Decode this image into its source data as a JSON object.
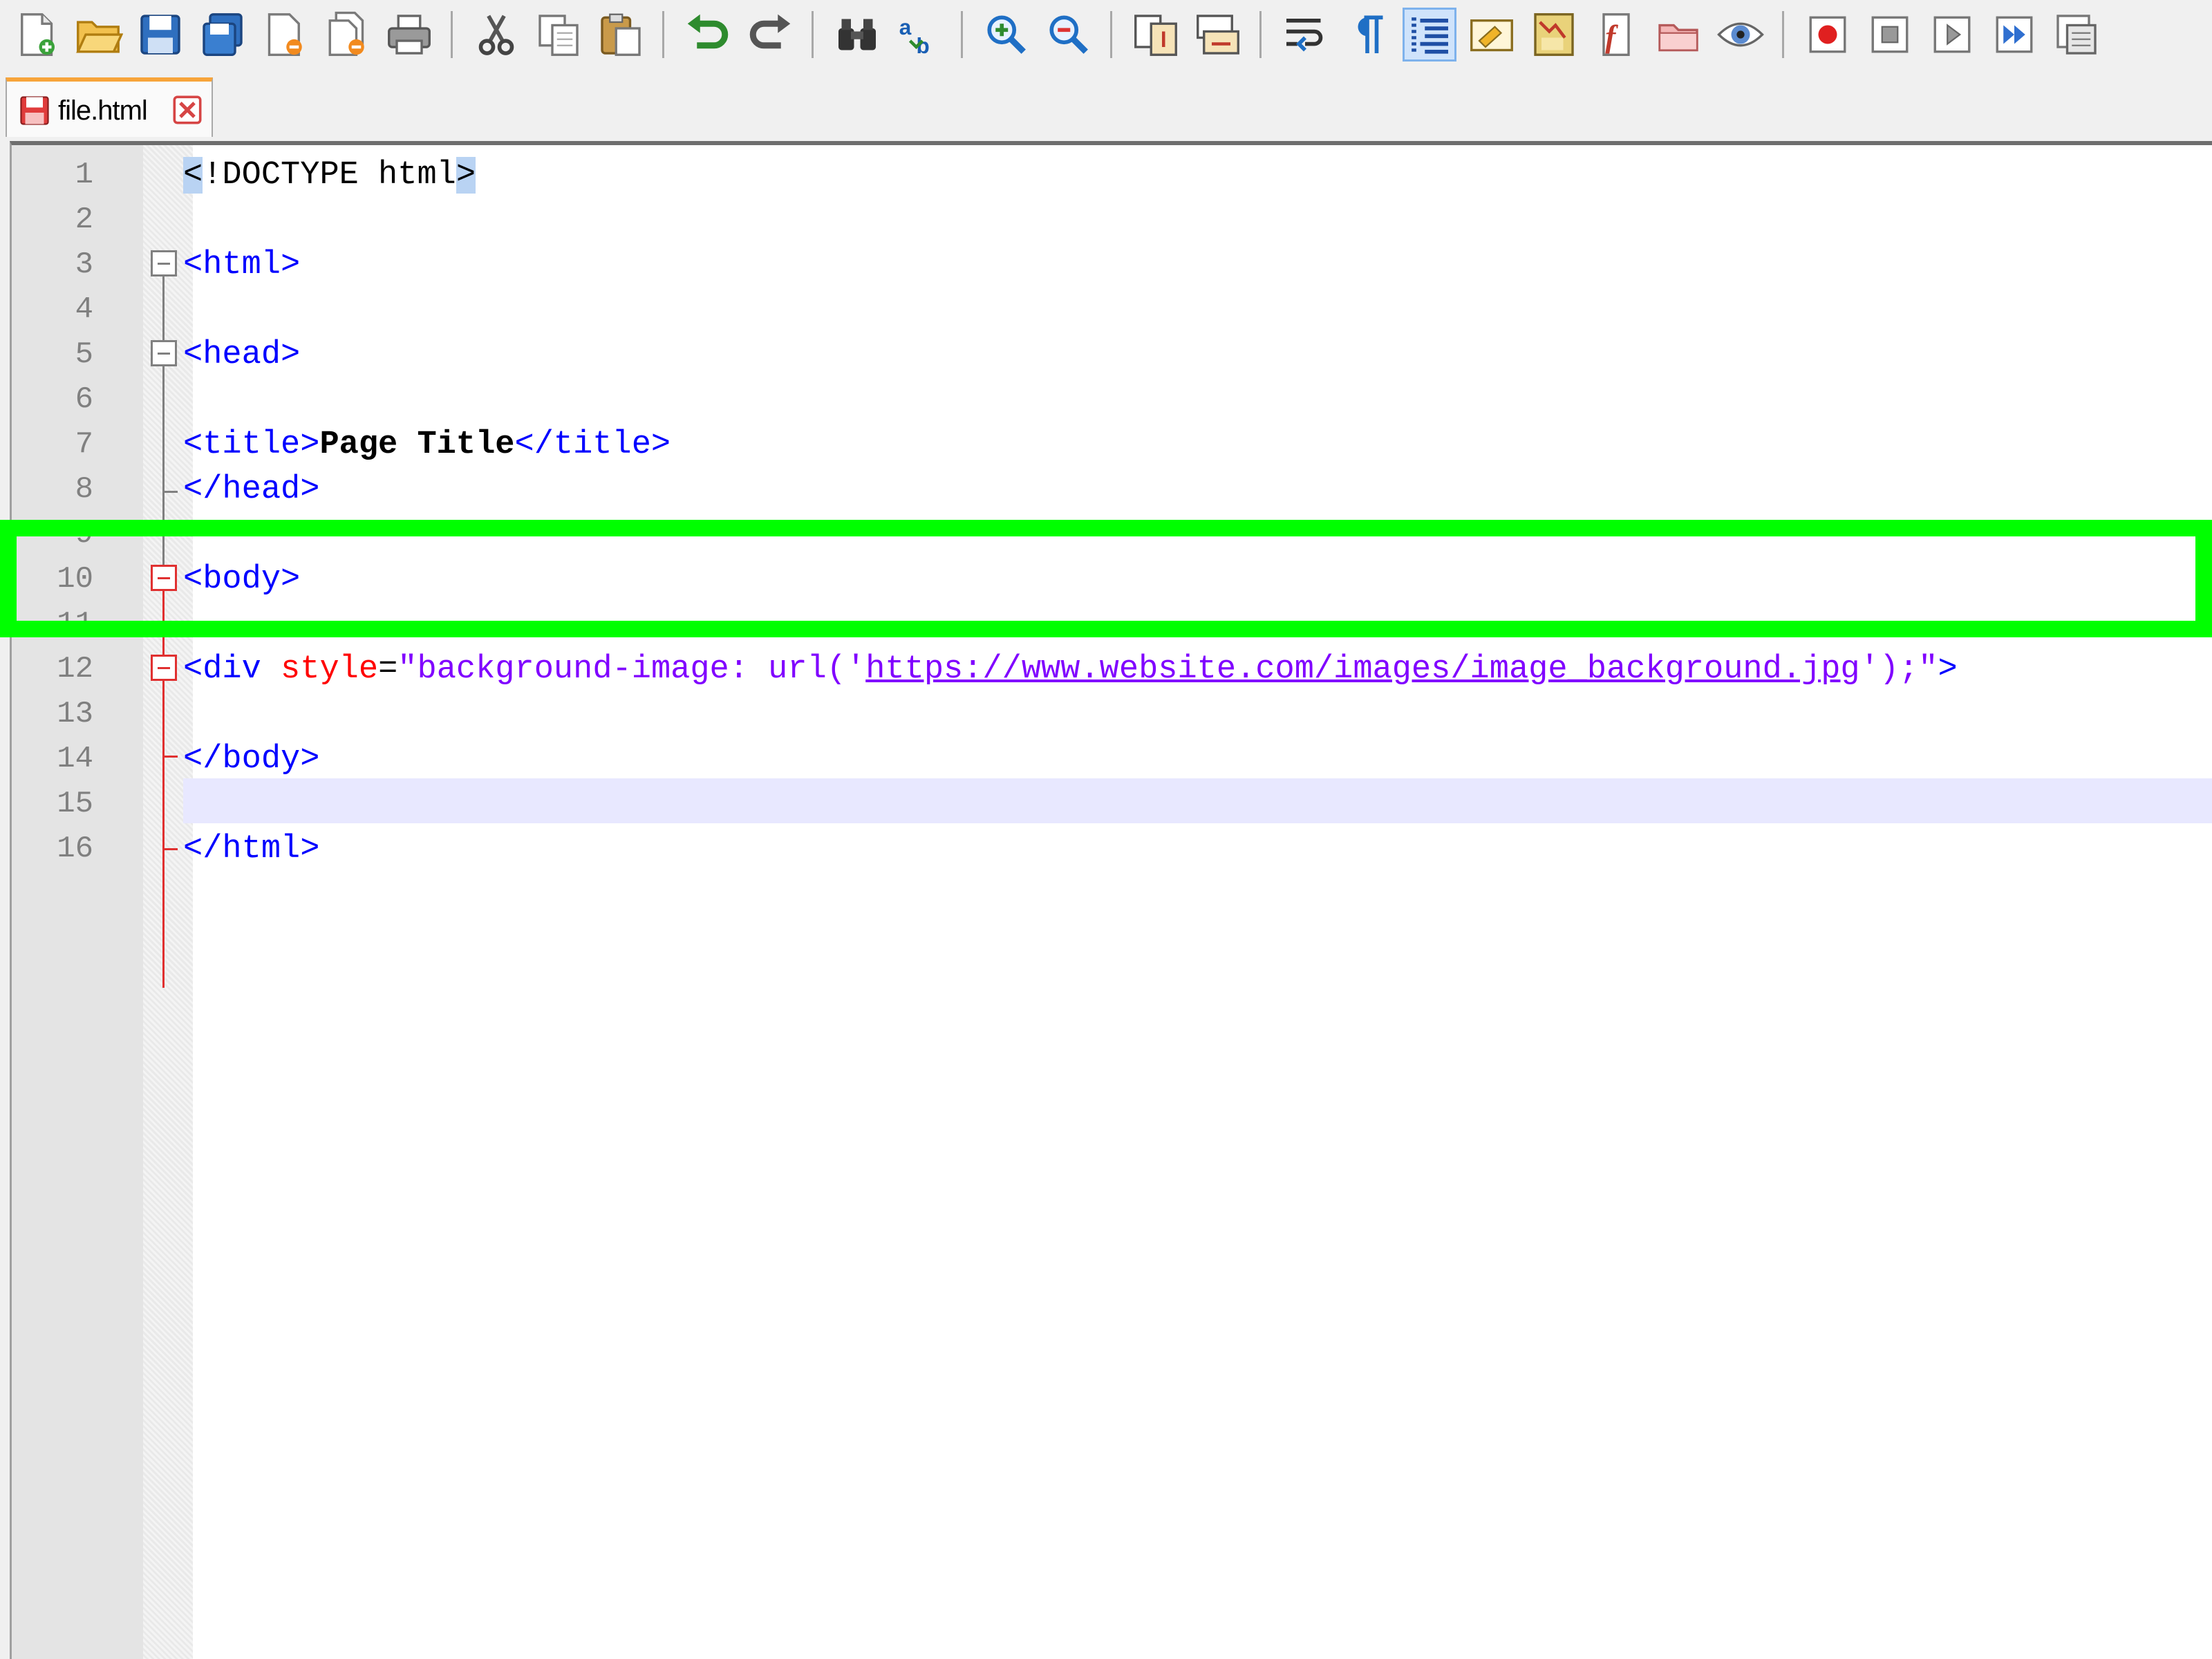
{
  "toolbar": {
    "buttons": [
      {
        "name": "new-file-icon"
      },
      {
        "name": "open-file-icon"
      },
      {
        "name": "save-icon"
      },
      {
        "name": "save-all-icon"
      },
      {
        "name": "close-icon"
      },
      {
        "name": "close-all-icon"
      },
      {
        "name": "print-icon"
      },
      {
        "name": "cut-icon"
      },
      {
        "name": "copy-icon"
      },
      {
        "name": "paste-icon"
      },
      {
        "name": "undo-icon"
      },
      {
        "name": "redo-icon"
      },
      {
        "name": "find-icon"
      },
      {
        "name": "replace-icon"
      },
      {
        "name": "zoom-in-icon"
      },
      {
        "name": "zoom-out-icon"
      },
      {
        "name": "sync-vertical-scroll-icon"
      },
      {
        "name": "sync-horizontal-scroll-icon"
      },
      {
        "name": "word-wrap-icon"
      },
      {
        "name": "show-all-characters-icon"
      },
      {
        "name": "indent-guide-icon"
      },
      {
        "name": "user-language-icon"
      },
      {
        "name": "document-map-icon"
      },
      {
        "name": "function-list-icon"
      },
      {
        "name": "folder-as-workspace-icon"
      },
      {
        "name": "monitoring-icon"
      },
      {
        "name": "record-macro-icon"
      },
      {
        "name": "stop-recording-icon"
      },
      {
        "name": "playback-macro-icon"
      },
      {
        "name": "run-macro-multiple-icon"
      },
      {
        "name": "save-macro-icon"
      }
    ]
  },
  "tab": {
    "label": "file.html",
    "icon": "file-modified-icon",
    "close_icon": "tab-close-icon",
    "accent": "#f7a43a"
  },
  "editor": {
    "line_numbers": [
      "1",
      "2",
      "3",
      "4",
      "5",
      "6",
      "7",
      "8",
      "9",
      "10",
      "11",
      "12",
      "13",
      "14",
      "15",
      "16"
    ],
    "current_line": 15,
    "highlighted_line": 10,
    "highlight_color": "#00ff00",
    "lines": {
      "l1": [
        "<",
        "!DOCTYPE html",
        ">"
      ],
      "l3": [
        "<html>"
      ],
      "l5": [
        "<head>"
      ],
      "l7": [
        "<title>",
        "Page Title",
        "</title>"
      ],
      "l8": [
        "</head>"
      ],
      "l10": [
        "<body>"
      ],
      "l12": [
        "<div ",
        "style",
        "=",
        "\"background-image: url('",
        "https://www.website.com/images/image_background.jpg",
        "');\"",
        ">"
      ],
      "l14": [
        "</body>"
      ],
      "l16": [
        "</html>"
      ]
    }
  }
}
